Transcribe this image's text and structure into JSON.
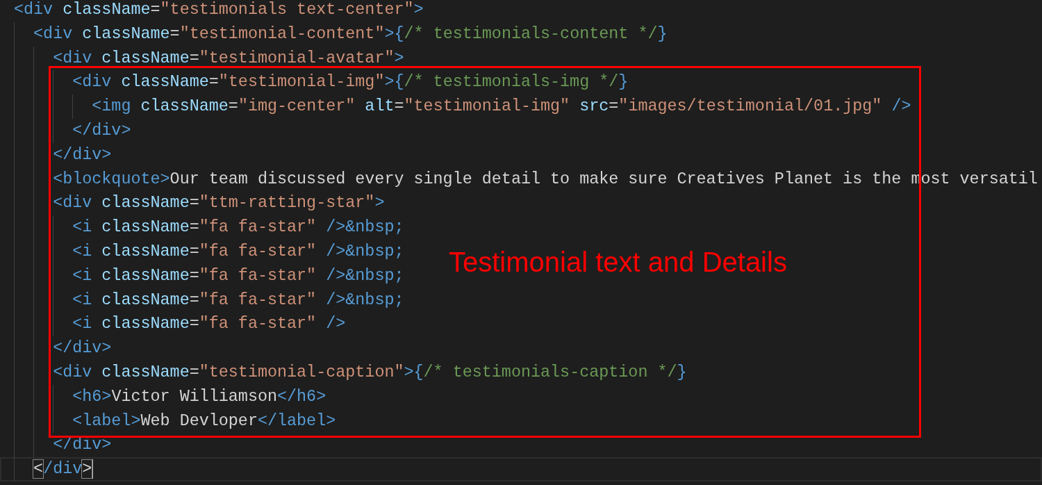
{
  "editor": {
    "lines": [
      {
        "current": false,
        "tokens": [
          {
            "kind": "tag",
            "text": "<div"
          },
          {
            "kind": "attr",
            "text": " className"
          },
          {
            "kind": "plain",
            "text": "="
          },
          {
            "kind": "string",
            "text": "\"testimonials text-center\""
          },
          {
            "kind": "tag",
            "text": ">"
          }
        ]
      },
      {
        "current": false,
        "tokens": [
          {
            "kind": "tag",
            "text": "  <div"
          },
          {
            "kind": "attr",
            "text": " className"
          },
          {
            "kind": "plain",
            "text": "="
          },
          {
            "kind": "string",
            "text": "\"testimonial-content\""
          },
          {
            "kind": "tag",
            "text": ">{"
          },
          {
            "kind": "comment",
            "text": "/* testimonials-content */"
          },
          {
            "kind": "tag",
            "text": "}"
          }
        ]
      },
      {
        "current": false,
        "tokens": [
          {
            "kind": "tag",
            "text": "    <div"
          },
          {
            "kind": "attr",
            "text": " className"
          },
          {
            "kind": "plain",
            "text": "="
          },
          {
            "kind": "string",
            "text": "\"testimonial-avatar\""
          },
          {
            "kind": "tag",
            "text": ">"
          }
        ]
      },
      {
        "current": false,
        "tokens": [
          {
            "kind": "tag",
            "text": "      <div"
          },
          {
            "kind": "attr",
            "text": " className"
          },
          {
            "kind": "plain",
            "text": "="
          },
          {
            "kind": "string",
            "text": "\"testimonial-img\""
          },
          {
            "kind": "tag",
            "text": ">{"
          },
          {
            "kind": "comment",
            "text": "/* testimonials-img */"
          },
          {
            "kind": "tag",
            "text": "}"
          }
        ]
      },
      {
        "current": false,
        "tokens": [
          {
            "kind": "tag",
            "text": "        <img"
          },
          {
            "kind": "attr",
            "text": " className"
          },
          {
            "kind": "plain",
            "text": "="
          },
          {
            "kind": "string",
            "text": "\"img-center\""
          },
          {
            "kind": "attr",
            "text": " alt"
          },
          {
            "kind": "plain",
            "text": "="
          },
          {
            "kind": "string",
            "text": "\"testimonial-img\""
          },
          {
            "kind": "attr",
            "text": " src"
          },
          {
            "kind": "plain",
            "text": "="
          },
          {
            "kind": "string",
            "text": "\"images/testimonial/01.jpg\""
          },
          {
            "kind": "tag",
            "text": " />"
          }
        ]
      },
      {
        "current": false,
        "tokens": [
          {
            "kind": "tag",
            "text": "      </div>"
          }
        ]
      },
      {
        "current": false,
        "tokens": [
          {
            "kind": "tag",
            "text": "    </div>"
          }
        ]
      },
      {
        "current": false,
        "tokens": [
          {
            "kind": "tag",
            "text": "    <blockquote>"
          },
          {
            "kind": "plain",
            "text": "Our team discussed every single detail to make sure Creatives Planet is the most versatil"
          }
        ]
      },
      {
        "current": false,
        "tokens": [
          {
            "kind": "tag",
            "text": "    <div"
          },
          {
            "kind": "attr",
            "text": " className"
          },
          {
            "kind": "plain",
            "text": "="
          },
          {
            "kind": "string",
            "text": "\"ttm-ratting-star\""
          },
          {
            "kind": "tag",
            "text": ">"
          }
        ]
      },
      {
        "current": false,
        "tokens": [
          {
            "kind": "tag",
            "text": "      <i"
          },
          {
            "kind": "attr",
            "text": " className"
          },
          {
            "kind": "plain",
            "text": "="
          },
          {
            "kind": "string",
            "text": "\"fa fa-star\""
          },
          {
            "kind": "tag",
            "text": " />&nbsp;"
          }
        ]
      },
      {
        "current": false,
        "tokens": [
          {
            "kind": "tag",
            "text": "      <i"
          },
          {
            "kind": "attr",
            "text": " className"
          },
          {
            "kind": "plain",
            "text": "="
          },
          {
            "kind": "string",
            "text": "\"fa fa-star\""
          },
          {
            "kind": "tag",
            "text": " />&nbsp;"
          }
        ]
      },
      {
        "current": false,
        "tokens": [
          {
            "kind": "tag",
            "text": "      <i"
          },
          {
            "kind": "attr",
            "text": " className"
          },
          {
            "kind": "plain",
            "text": "="
          },
          {
            "kind": "string",
            "text": "\"fa fa-star\""
          },
          {
            "kind": "tag",
            "text": " />&nbsp;"
          }
        ]
      },
      {
        "current": false,
        "tokens": [
          {
            "kind": "tag",
            "text": "      <i"
          },
          {
            "kind": "attr",
            "text": " className"
          },
          {
            "kind": "plain",
            "text": "="
          },
          {
            "kind": "string",
            "text": "\"fa fa-star\""
          },
          {
            "kind": "tag",
            "text": " />&nbsp;"
          }
        ]
      },
      {
        "current": false,
        "tokens": [
          {
            "kind": "tag",
            "text": "      <i"
          },
          {
            "kind": "attr",
            "text": " className"
          },
          {
            "kind": "plain",
            "text": "="
          },
          {
            "kind": "string",
            "text": "\"fa fa-star\""
          },
          {
            "kind": "tag",
            "text": " />"
          }
        ]
      },
      {
        "current": false,
        "tokens": [
          {
            "kind": "tag",
            "text": "    </div>"
          }
        ]
      },
      {
        "current": false,
        "tokens": [
          {
            "kind": "tag",
            "text": "    <div"
          },
          {
            "kind": "attr",
            "text": " className"
          },
          {
            "kind": "plain",
            "text": "="
          },
          {
            "kind": "string",
            "text": "\"testimonial-caption\""
          },
          {
            "kind": "tag",
            "text": ">{"
          },
          {
            "kind": "comment",
            "text": "/* testimonials-caption */"
          },
          {
            "kind": "tag",
            "text": "}"
          }
        ]
      },
      {
        "current": false,
        "tokens": [
          {
            "kind": "tag",
            "text": "      <h6>"
          },
          {
            "kind": "plain",
            "text": "Victor Williamson"
          },
          {
            "kind": "tag",
            "text": "</h6>"
          }
        ]
      },
      {
        "current": false,
        "tokens": [
          {
            "kind": "tag",
            "text": "      <label>"
          },
          {
            "kind": "plain",
            "text": "Web Devloper"
          },
          {
            "kind": "tag",
            "text": "</label>"
          }
        ]
      },
      {
        "current": false,
        "tokens": [
          {
            "kind": "tag",
            "text": "    </div>"
          }
        ]
      },
      {
        "current": true,
        "tokens": [
          {
            "kind": "match",
            "text": "  <"
          },
          {
            "kind": "tag",
            "text": "/div"
          },
          {
            "kind": "match",
            "text": ">"
          }
        ]
      }
    ]
  },
  "annotation": {
    "label": "Testimonial text and Details"
  }
}
